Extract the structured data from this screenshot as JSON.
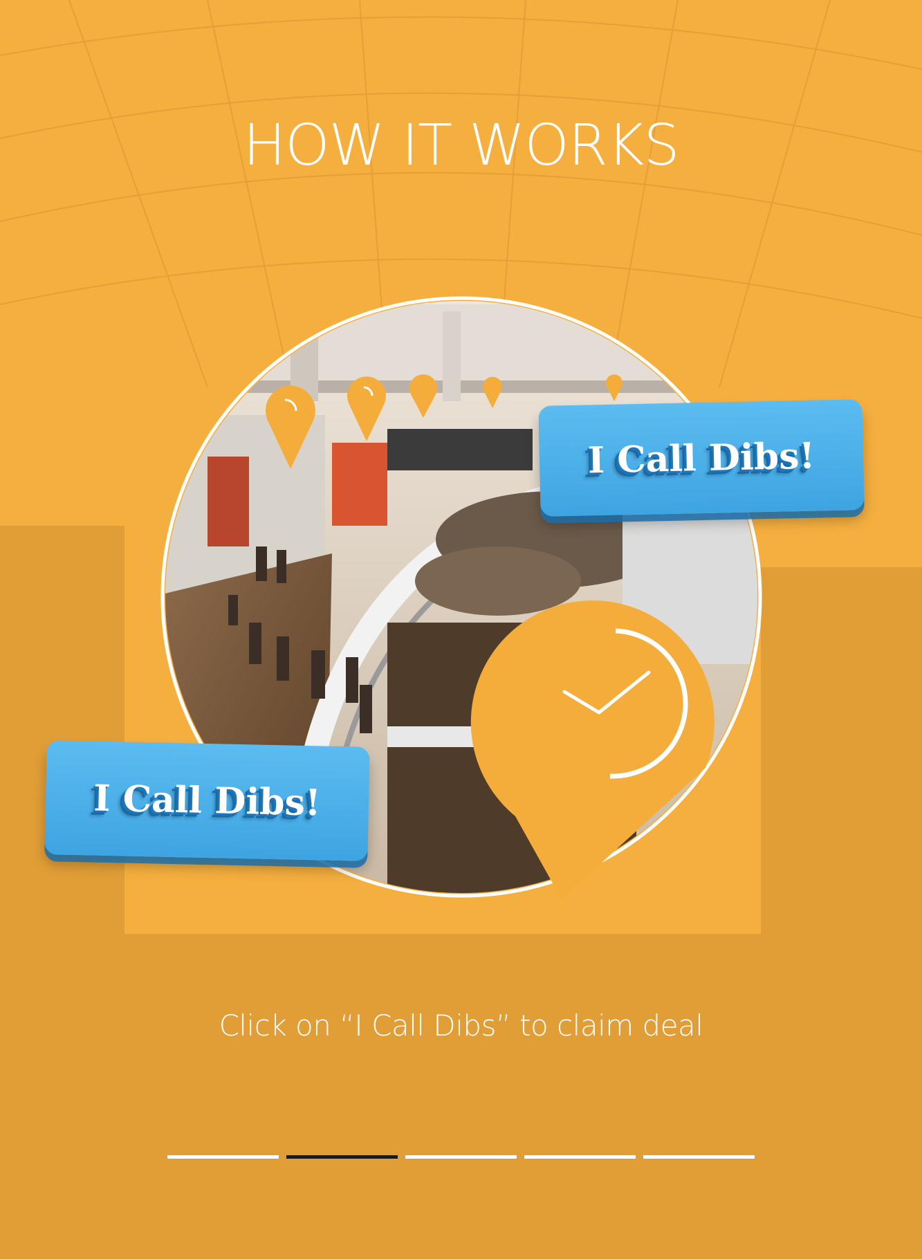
{
  "header": {
    "title": "HOW IT WORKS"
  },
  "illustration": {
    "callout_label": "I Call Dibs!",
    "map_pin_icon": "map-pin-icon",
    "clock_pin_icon": "clock-pin-icon"
  },
  "caption": "Click on “I Call Dibs” to claim deal",
  "pager": {
    "total": 5,
    "active_index": 1
  },
  "colors": {
    "background": "#F5AF3F",
    "accent_orange": "#F4AC3A",
    "callout_blue": "#4AAFE8",
    "callout_blue_dark": "#1F75B8",
    "ring_white": "#FFFFFF",
    "pager_active": "#1A1A1A",
    "pager_inactive": "#FFFFFF"
  }
}
